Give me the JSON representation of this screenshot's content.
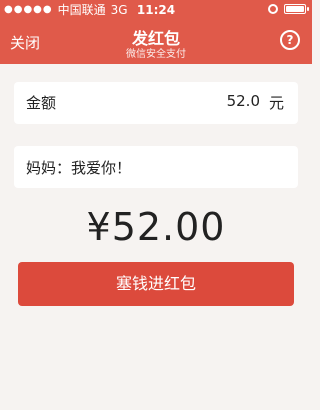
{
  "status_bar": {
    "carrier": "中国联通",
    "network": "3G",
    "time": "11:24"
  },
  "header": {
    "close_label": "关闭",
    "title": "发红包",
    "subtitle": "微信安全支付",
    "help_label": "?"
  },
  "amount_field": {
    "label": "金额",
    "value": "52.0",
    "unit": "元"
  },
  "message_field": {
    "value": "妈妈：我爱你！"
  },
  "total": {
    "display": "¥52.00"
  },
  "send_button": {
    "label": "塞钱进红包"
  },
  "colors": {
    "header_bg": "#e05a4a",
    "button_bg": "#dc4a3c",
    "page_bg": "#f6f3f1"
  },
  "icons": {
    "signal": "signal-dots-icon",
    "lock": "orientation-lock-icon",
    "battery": "battery-icon",
    "help": "help-icon"
  }
}
